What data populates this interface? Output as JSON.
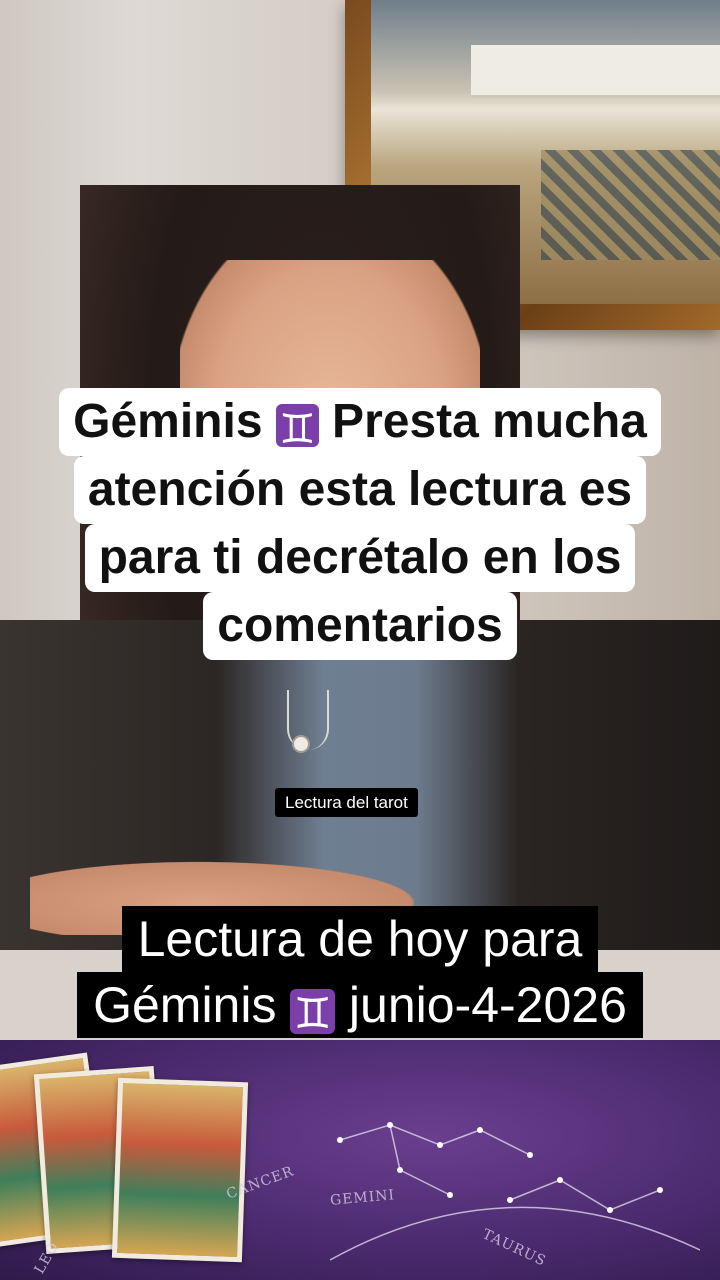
{
  "scene": {
    "description_icon": "tarot-reader-video-frame"
  },
  "caption_top": {
    "line1_a": "Géminis",
    "zodiac_symbol": "♊",
    "line1_b": "Presta mucha",
    "line2": "atención esta lectura es",
    "line3": "para ti decrétalo en los",
    "line4": "comentarios"
  },
  "label": {
    "text": "Lectura del tarot"
  },
  "caption_bottom": {
    "line1": "Lectura de hoy para",
    "line2_a": "Géminis",
    "zodiac_symbol": "♊",
    "line2_b": "junio-4-2026"
  },
  "cloth_text": {
    "t1": "GEMINI",
    "t2": "CANCER",
    "t3": "TAURUS",
    "t4": "LEO"
  },
  "colors": {
    "zodiac_badge": "#7a3fa8",
    "caption_bg_top": "#ffffff",
    "caption_bg_bottom": "#000000",
    "cloth": "#4a2a6e"
  }
}
